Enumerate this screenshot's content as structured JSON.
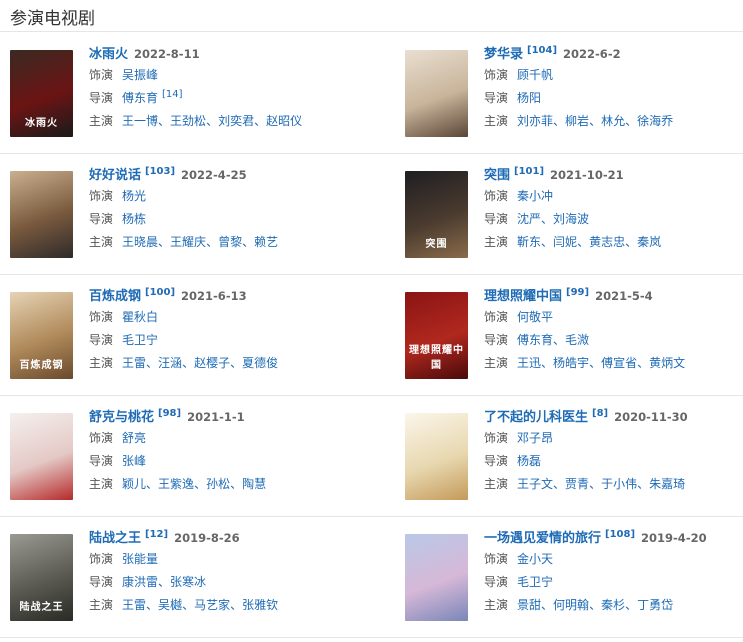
{
  "section": {
    "title": "参演电视剧"
  },
  "items": [
    {
      "title": "冰雨火",
      "ref": "",
      "date": "2022-8-11",
      "roles": [
        {
          "label": "饰演",
          "names": [
            "吴振峰"
          ],
          "ref": ""
        },
        {
          "label": "导演",
          "names": [
            "傅东育"
          ],
          "ref": "[14]"
        },
        {
          "label": "主演",
          "names": [
            "王一博",
            "王劲松",
            "刘奕君",
            "赵昭仪"
          ],
          "ref": ""
        }
      ],
      "poster_caption": "冰雨火",
      "poster_colors": [
        "#3a2a22",
        "#6b1414",
        "#1a1a1a"
      ]
    },
    {
      "title": "梦华录",
      "ref": "[104]",
      "date": "2022-6-2",
      "roles": [
        {
          "label": "饰演",
          "names": [
            "顾千帆"
          ],
          "ref": ""
        },
        {
          "label": "导演",
          "names": [
            "杨阳"
          ],
          "ref": ""
        },
        {
          "label": "主演",
          "names": [
            "刘亦菲",
            "柳岩",
            "林允",
            "徐海乔"
          ],
          "ref": ""
        }
      ],
      "poster_caption": "",
      "poster_colors": [
        "#e9dfd2",
        "#c8b49a",
        "#5a4636"
      ]
    },
    {
      "title": "好好说话",
      "ref": "[103]",
      "date": "2022-4-25",
      "roles": [
        {
          "label": "饰演",
          "names": [
            "杨光"
          ],
          "ref": ""
        },
        {
          "label": "导演",
          "names": [
            "杨栋"
          ],
          "ref": ""
        },
        {
          "label": "主演",
          "names": [
            "王晓晨",
            "王耀庆",
            "曾黎",
            "赖艺"
          ],
          "ref": ""
        }
      ],
      "poster_caption": "",
      "poster_colors": [
        "#c9b08f",
        "#7a5a3e",
        "#2e2a2a"
      ]
    },
    {
      "title": "突围",
      "ref": "[101]",
      "date": "2021-10-21",
      "roles": [
        {
          "label": "饰演",
          "names": [
            "秦小冲"
          ],
          "ref": ""
        },
        {
          "label": "导演",
          "names": [
            "沈严",
            "刘海波"
          ],
          "ref": ""
        },
        {
          "label": "主演",
          "names": [
            "靳东",
            "闫妮",
            "黄志忠",
            "秦岚"
          ],
          "ref": ""
        }
      ],
      "poster_caption": "突围",
      "poster_colors": [
        "#1e1e22",
        "#4a3b2f",
        "#8a6b4a"
      ]
    },
    {
      "title": "百炼成钢",
      "ref": "[100]",
      "date": "2021-6-13",
      "roles": [
        {
          "label": "饰演",
          "names": [
            "瞿秋白"
          ],
          "ref": ""
        },
        {
          "label": "导演",
          "names": [
            "毛卫宁"
          ],
          "ref": ""
        },
        {
          "label": "主演",
          "names": [
            "王雷",
            "汪涵",
            "赵樱子",
            "夏德俊"
          ],
          "ref": ""
        }
      ],
      "poster_caption": "百炼成钢",
      "poster_colors": [
        "#e6d3b5",
        "#b08a5a",
        "#6a4a2e"
      ]
    },
    {
      "title": "理想照耀中国",
      "ref": "[99]",
      "date": "2021-5-4",
      "roles": [
        {
          "label": "饰演",
          "names": [
            "何敬平"
          ],
          "ref": ""
        },
        {
          "label": "导演",
          "names": [
            "傅东育",
            "毛溦"
          ],
          "ref": ""
        },
        {
          "label": "主演",
          "names": [
            "王迅",
            "杨皓宇",
            "傅宣省",
            "黄炳文"
          ],
          "ref": ""
        }
      ],
      "poster_caption": "理想照耀中国",
      "poster_colors": [
        "#8a1414",
        "#b0281e",
        "#4a0a0a"
      ]
    },
    {
      "title": "舒克与桃花",
      "ref": "[98]",
      "date": "2021-1-1",
      "roles": [
        {
          "label": "饰演",
          "names": [
            "舒亮"
          ],
          "ref": ""
        },
        {
          "label": "导演",
          "names": [
            "张峰"
          ],
          "ref": ""
        },
        {
          "label": "主演",
          "names": [
            "颖儿",
            "王紫逸",
            "孙松",
            "陶慧"
          ],
          "ref": ""
        }
      ],
      "poster_caption": "",
      "poster_colors": [
        "#f4f0ee",
        "#e4c9c6",
        "#b52a2a"
      ]
    },
    {
      "title": "了不起的儿科医生",
      "ref": "[8]",
      "date": "2020-11-30",
      "roles": [
        {
          "label": "饰演",
          "names": [
            "邓子昂"
          ],
          "ref": ""
        },
        {
          "label": "导演",
          "names": [
            "杨磊"
          ],
          "ref": ""
        },
        {
          "label": "主演",
          "names": [
            "王子文",
            "贾青",
            "于小伟",
            "朱嘉琦"
          ],
          "ref": ""
        }
      ],
      "poster_caption": "",
      "poster_colors": [
        "#fbf6ea",
        "#e8d8b0",
        "#c49a5a"
      ]
    },
    {
      "title": "陆战之王",
      "ref": "[12]",
      "date": "2019-8-26",
      "roles": [
        {
          "label": "饰演",
          "names": [
            "张能量"
          ],
          "ref": ""
        },
        {
          "label": "导演",
          "names": [
            "康洪雷",
            "张寒冰"
          ],
          "ref": ""
        },
        {
          "label": "主演",
          "names": [
            "王雷",
            "吴樾",
            "马艺家",
            "张雅钦"
          ],
          "ref": ""
        }
      ],
      "poster_caption": "陆战之王",
      "poster_colors": [
        "#9a9a92",
        "#5a5a52",
        "#2a2a26"
      ]
    },
    {
      "title": "一场遇见爱情的旅行",
      "ref": "[108]",
      "date": "2019-4-20",
      "roles": [
        {
          "label": "饰演",
          "names": [
            "金小天"
          ],
          "ref": ""
        },
        {
          "label": "导演",
          "names": [
            "毛卫宁"
          ],
          "ref": ""
        },
        {
          "label": "主演",
          "names": [
            "景甜",
            "何明翰",
            "秦杉",
            "丁勇岱"
          ],
          "ref": ""
        }
      ],
      "poster_caption": "",
      "poster_colors": [
        "#b9c8e6",
        "#d6b8d8",
        "#7a86b8"
      ]
    }
  ]
}
